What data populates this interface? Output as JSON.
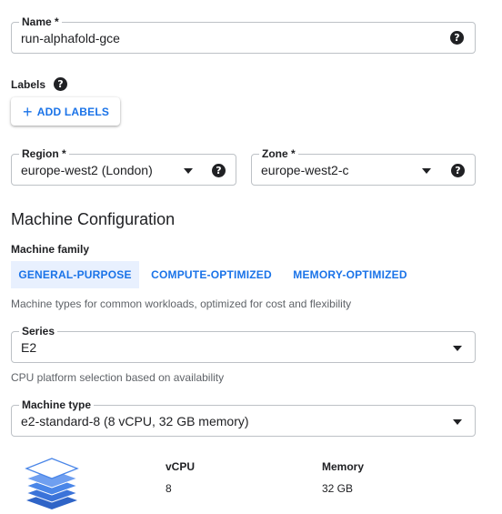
{
  "name_field": {
    "label": "Name *",
    "value": "run-alphafold-gce",
    "help_icon": "help-icon"
  },
  "labels_section": {
    "label": "Labels",
    "help_icon": "help-icon",
    "add_button": {
      "icon": "plus-icon",
      "label": "ADD LABELS"
    }
  },
  "region_field": {
    "label": "Region *",
    "value": "europe-west2 (London)",
    "arrow_icon": "dropdown-arrow-icon",
    "help_icon": "help-icon"
  },
  "zone_field": {
    "label": "Zone *",
    "value": "europe-west2-c",
    "arrow_icon": "dropdown-arrow-icon",
    "help_icon": "help-icon"
  },
  "machine_config": {
    "heading": "Machine Configuration",
    "family_label": "Machine family",
    "tabs": [
      {
        "label": "GENERAL-PURPOSE",
        "selected": true
      },
      {
        "label": "COMPUTE-OPTIMIZED",
        "selected": false
      },
      {
        "label": "MEMORY-OPTIMIZED",
        "selected": false
      }
    ],
    "family_description": "Machine types for common workloads, optimized for cost and flexibility",
    "series": {
      "label": "Series",
      "value": "E2",
      "hint": "CPU platform selection based on availability"
    },
    "machine_type": {
      "label": "Machine type",
      "value": "e2-standard-8 (8 vCPU, 32 GB memory)"
    },
    "summary": {
      "icon": "layers-stack-icon",
      "vcpu_label": "vCPU",
      "vcpu_value": "8",
      "memory_label": "Memory",
      "memory_value": "32 GB"
    }
  },
  "colors": {
    "accent": "#1a73e8",
    "selected_tab_bg": "#e8f0fe",
    "text": "#202124",
    "secondary_text": "#5f6368",
    "border": "#bdc1c6",
    "layers_icon": "#4a86e8"
  }
}
